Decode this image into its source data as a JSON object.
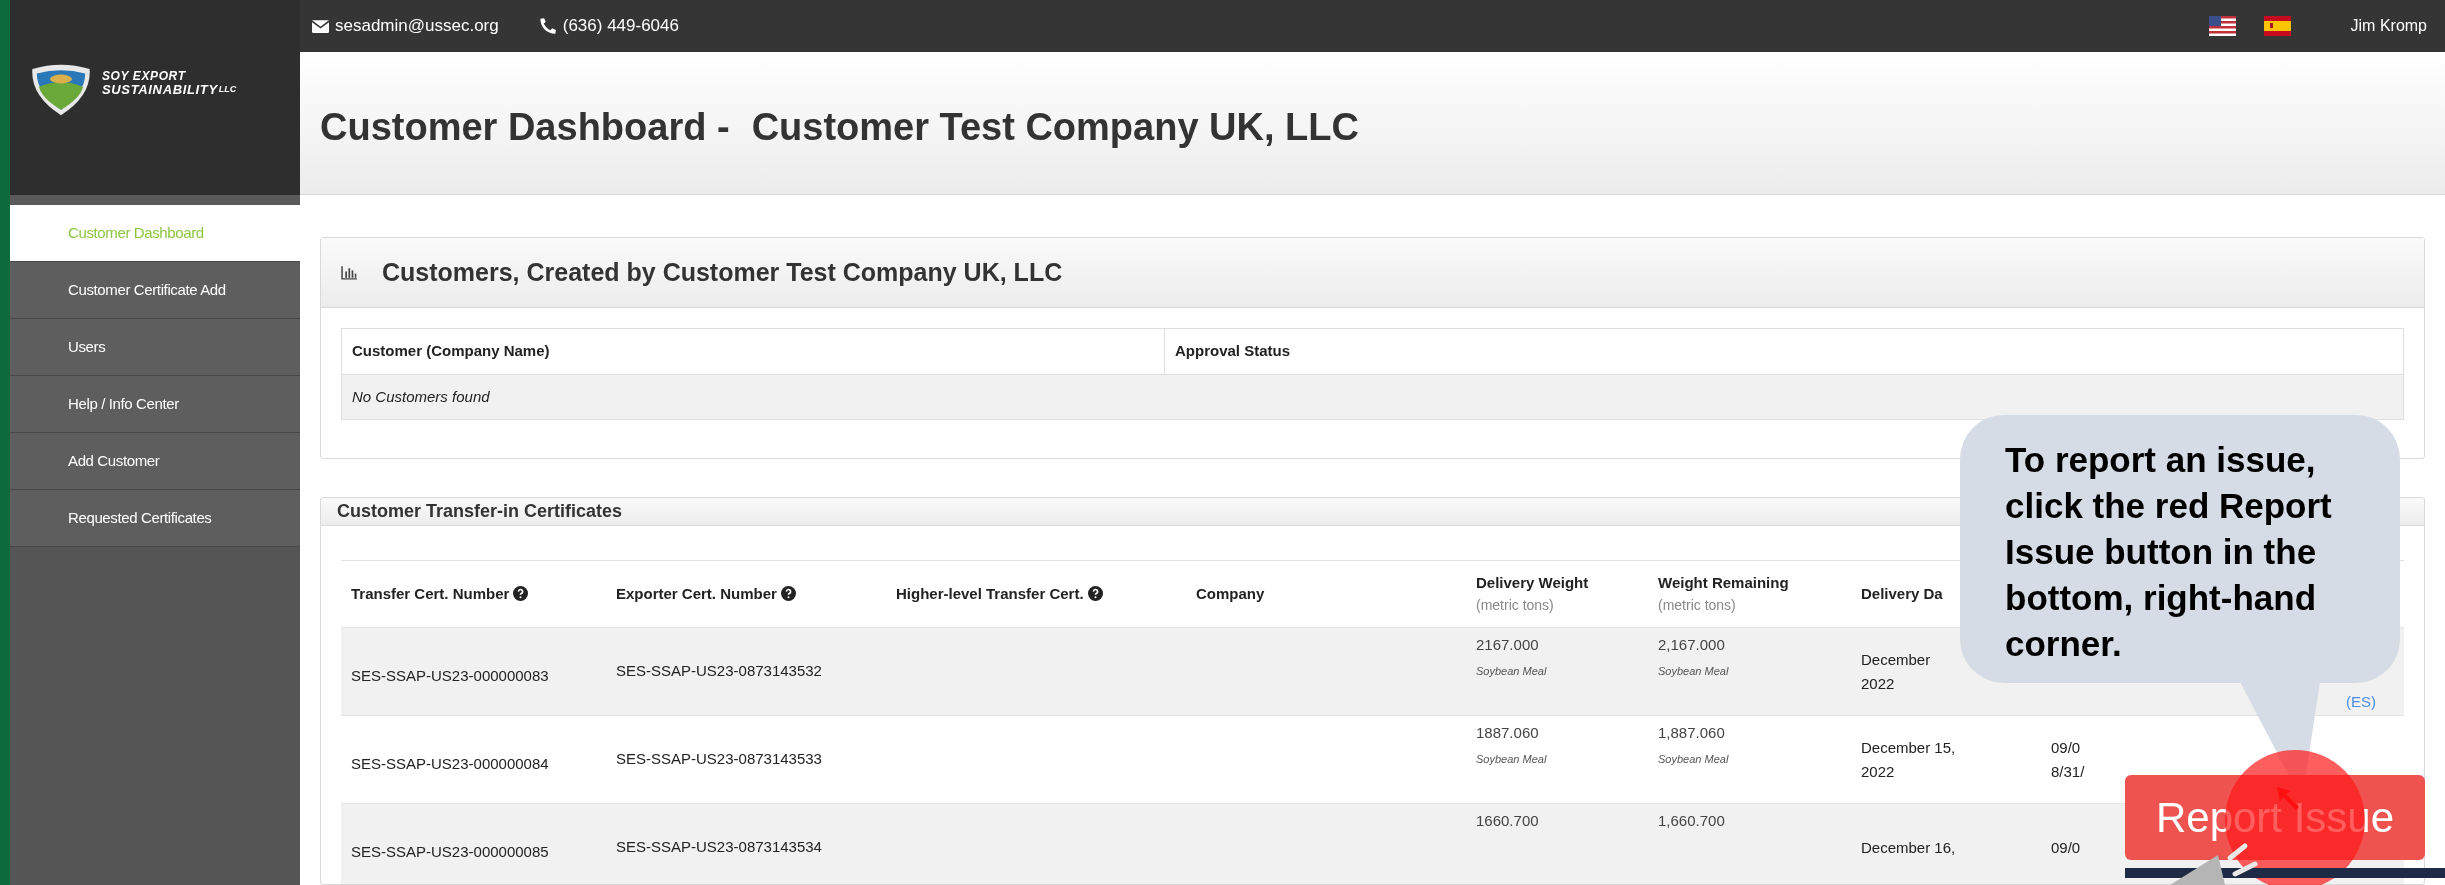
{
  "topbar": {
    "email": "sesadmin@ussec.org",
    "phone": "(636) 449-6046",
    "user": "Jim Kromp"
  },
  "logo": {
    "line_1": "SOY EXPORT",
    "line_2": "SUSTAINABILITY",
    "suffix": "LLC"
  },
  "page_title": {
    "prefix": "Customer Dashboard -",
    "company": "Customer Test Company UK, LLC"
  },
  "sidebar": {
    "items": [
      {
        "label": "Customer Dashboard",
        "selected": true
      },
      {
        "label": "Customer Certificate Add",
        "selected": false
      },
      {
        "label": "Users",
        "selected": false
      },
      {
        "label": "Help / Info Center",
        "selected": false
      },
      {
        "label": "Add Customer",
        "selected": false
      },
      {
        "label": "Requested Certificates",
        "selected": false
      }
    ]
  },
  "customers_panel": {
    "title": "Customers, Created by Customer Test Company UK, LLC",
    "columns": [
      "Customer (Company Name)",
      "Approval Status"
    ],
    "empty_message": "No Customers found"
  },
  "transfer_panel": {
    "title": "Customer Transfer-in Certificates",
    "columns": [
      {
        "label": "Transfer Cert. Number",
        "help": true
      },
      {
        "label": "Exporter Cert. Number",
        "help": true
      },
      {
        "label": "Higher-level Transfer Cert.",
        "help": true
      },
      {
        "label": "Company",
        "help": false
      },
      {
        "label": "Delivery Weight",
        "sub": "(metric tons)",
        "help": false
      },
      {
        "label": "Weight Remaining",
        "sub": "(metric tons)",
        "help": false
      },
      {
        "label": "Delivery Da",
        "help": false
      }
    ],
    "rows": [
      {
        "transfer": "SES-SSAP-US23-000000083",
        "exporter": "SES-SSAP-US23-0873143532",
        "delivery_weight": "2167.000",
        "delivery_product": "Soybean Meal",
        "weight_remaining": "2,167.000",
        "remaining_product": "Soybean Meal",
        "delivery_date": [
          "December",
          "2022"
        ],
        "column_8": "(ES)"
      },
      {
        "transfer": "SES-SSAP-US23-000000084",
        "exporter": "SES-SSAP-US23-0873143533",
        "delivery_weight": "1887.060",
        "delivery_product": "Soybean Meal",
        "weight_remaining": "1,887.060",
        "remaining_product": "Soybean Meal",
        "delivery_date": [
          "December 15,",
          "2022"
        ],
        "column_7": [
          "09/0",
          "8/31/"
        ]
      },
      {
        "transfer": "SES-SSAP-US23-000000085",
        "exporter": "SES-SSAP-US23-0873143534",
        "delivery_weight": "1660.700",
        "weight_remaining": "1,660.700",
        "delivery_date": [
          "December 16,"
        ],
        "column_7": [
          "09/0"
        ]
      }
    ]
  },
  "callout": {
    "text": "To report an issue, click the red Report Issue button in the bottom, right-hand corner."
  },
  "report_button": {
    "label": "Report Issue"
  }
}
